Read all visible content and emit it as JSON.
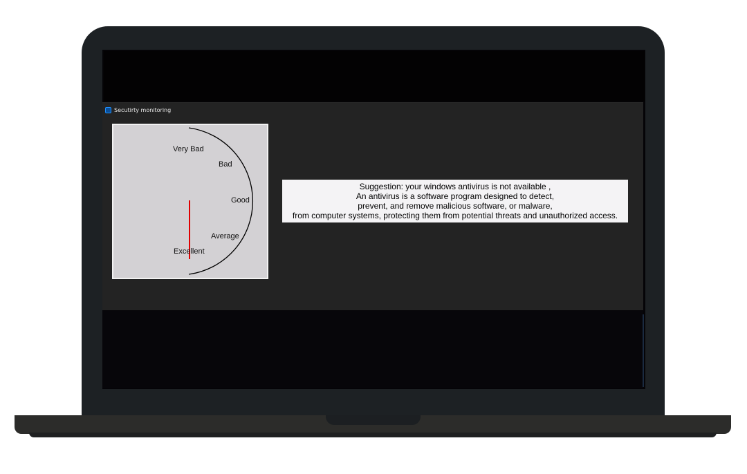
{
  "window": {
    "title": "Secutirty monitoring"
  },
  "gauge": {
    "labels": {
      "very_bad": "Very Bad",
      "bad": "Bad",
      "good": "Good",
      "average": "Average",
      "excellent": "Excellent"
    },
    "needle_color": "#e00000",
    "arc_color": "#000000",
    "needle_reading": "Excellent"
  },
  "suggestion": {
    "lines": [
      "Suggestion: your windows antivirus is not available ,",
      "An antivirus is a software program designed to detect,",
      "prevent, and remove malicious software, or malware,",
      "from computer systems, protecting them from potential threats and unauthorized access."
    ]
  },
  "icons": {
    "app": "app-window-icon"
  },
  "colors": {
    "window_bg": "#232323",
    "panel_bg": "#d3d1d4",
    "laptop_body": "#1d2124"
  }
}
